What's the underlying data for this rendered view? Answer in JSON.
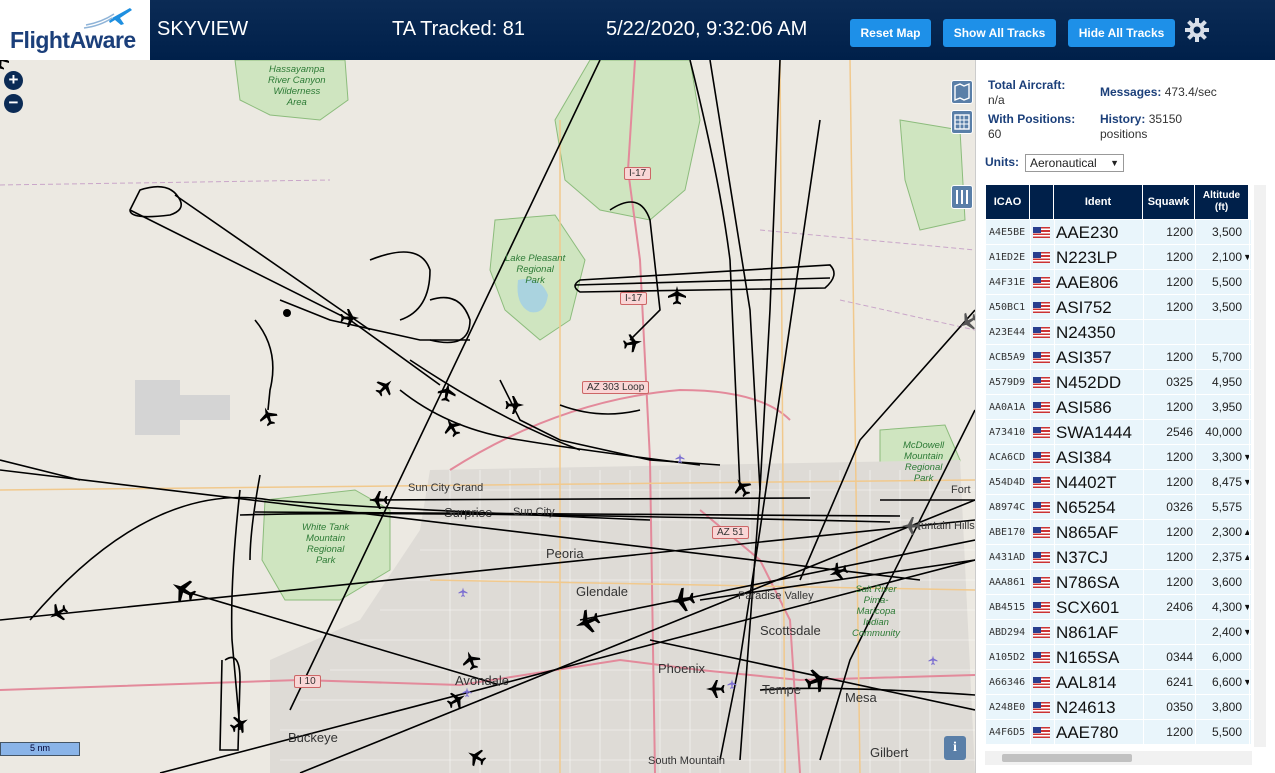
{
  "header": {
    "logo_text": "FlightAware",
    "app_title": "SKYVIEW",
    "tracked_text": "TA Tracked: 81",
    "datetime": "5/22/2020, 9:32:06 AM",
    "reset_label": "Reset Map",
    "show_label": "Show All Tracks",
    "hide_label": "Hide All Tracks",
    "settings_icon": "gear-icon"
  },
  "map": {
    "zoom_in": "+",
    "zoom_out": "−",
    "scale_label": "5 nm",
    "labels": {
      "hassayampa": "Hassayampa\nRiver Canyon\nWilderness\nArea",
      "lake_pleasant": "Lake Pleasant\nRegional\nPark",
      "white_tank": "White Tank\nMountain\nRegional\nPark",
      "mcdowell": "McDowell\nMountain\nRegional\nPark",
      "salt_river": "Salt River\nPima-\nMaricopa\nIndian\nCommunity",
      "sun_city_grand": "Sun City Grand",
      "surprise": "Surprise",
      "sun_city": "Sun City",
      "peoria": "Peoria",
      "glendale": "Glendale",
      "paradise_valley": "Paradise Valley",
      "scottsdale": "Scottsdale",
      "phoenix": "Phoenix",
      "avondale": "Avondale",
      "tempe": "Tempe",
      "mesa": "Mesa",
      "buckeye": "Buckeye",
      "gilbert": "Gilbert",
      "fort": "Fort",
      "mountain_hills": "untain Hills",
      "south_mountain": "South Mountain"
    },
    "shields": {
      "i17_a": "I-17",
      "i17_b": "I-17",
      "az303": "AZ 303 Loop",
      "az51": "AZ 51",
      "i10": "I 10"
    }
  },
  "stats": {
    "total_label": "Total Aircraft:",
    "total_value": "n/a",
    "messages_label": "Messages:",
    "messages_value": "473.4/sec",
    "positions_label": "With Positions:",
    "positions_value": "60",
    "history_label": "History:",
    "history_value": "35150",
    "history_unit": "positions",
    "units_label": "Units:",
    "units_value": "Aeronautical"
  },
  "table": {
    "headers": {
      "icao": "ICAO",
      "ident": "Ident",
      "squawk": "Squawk",
      "altitude": "Altitude\n(ft)"
    },
    "rows": [
      {
        "icao": "A4E5BE",
        "ident": "AAE230",
        "squawk": "1200",
        "alt": "3,500",
        "trend": ""
      },
      {
        "icao": "A1ED2E",
        "ident": "N223LP",
        "squawk": "1200",
        "alt": "2,100",
        "trend": "▼"
      },
      {
        "icao": "A4F31E",
        "ident": "AAE806",
        "squawk": "1200",
        "alt": "5,500",
        "trend": ""
      },
      {
        "icao": "A50BC1",
        "ident": "ASI752",
        "squawk": "1200",
        "alt": "3,500",
        "trend": ""
      },
      {
        "icao": "A23E44",
        "ident": "N24350",
        "squawk": "",
        "alt": "",
        "trend": ""
      },
      {
        "icao": "ACB5A9",
        "ident": "ASI357",
        "squawk": "1200",
        "alt": "5,700",
        "trend": ""
      },
      {
        "icao": "A579D9",
        "ident": "N452DD",
        "squawk": "0325",
        "alt": "4,950",
        "trend": ""
      },
      {
        "icao": "AA0A1A",
        "ident": "ASI586",
        "squawk": "1200",
        "alt": "3,950",
        "trend": ""
      },
      {
        "icao": "A73410",
        "ident": "SWA1444",
        "squawk": "2546",
        "alt": "40,000",
        "trend": ""
      },
      {
        "icao": "ACA6CD",
        "ident": "ASI384",
        "squawk": "1200",
        "alt": "3,300",
        "trend": "▼"
      },
      {
        "icao": "A54D4D",
        "ident": "N4402T",
        "squawk": "1200",
        "alt": "8,475",
        "trend": "▼"
      },
      {
        "icao": "A8974C",
        "ident": "N65254",
        "squawk": "0326",
        "alt": "5,575",
        "trend": ""
      },
      {
        "icao": "ABE170",
        "ident": "N865AF",
        "squawk": "1200",
        "alt": "2,300",
        "trend": "▲"
      },
      {
        "icao": "A431AD",
        "ident": "N37CJ",
        "squawk": "1200",
        "alt": "2,375",
        "trend": "▲"
      },
      {
        "icao": "AAA861",
        "ident": "N786SA",
        "squawk": "1200",
        "alt": "3,600",
        "trend": ""
      },
      {
        "icao": "AB4515",
        "ident": "SCX601",
        "squawk": "2406",
        "alt": "4,300",
        "trend": "▼"
      },
      {
        "icao": "ABD294",
        "ident": "N861AF",
        "squawk": "",
        "alt": "2,400",
        "trend": "▼"
      },
      {
        "icao": "A105D2",
        "ident": "N165SA",
        "squawk": "0344",
        "alt": "6,000",
        "trend": ""
      },
      {
        "icao": "A66346",
        "ident": "AAL814",
        "squawk": "6241",
        "alt": "6,600",
        "trend": "▼"
      },
      {
        "icao": "A248E0",
        "ident": "N24613",
        "squawk": "0350",
        "alt": "3,800",
        "trend": ""
      },
      {
        "icao": "A4F6D5",
        "ident": "AAE780",
        "squawk": "1200",
        "alt": "5,500",
        "trend": ""
      }
    ]
  }
}
